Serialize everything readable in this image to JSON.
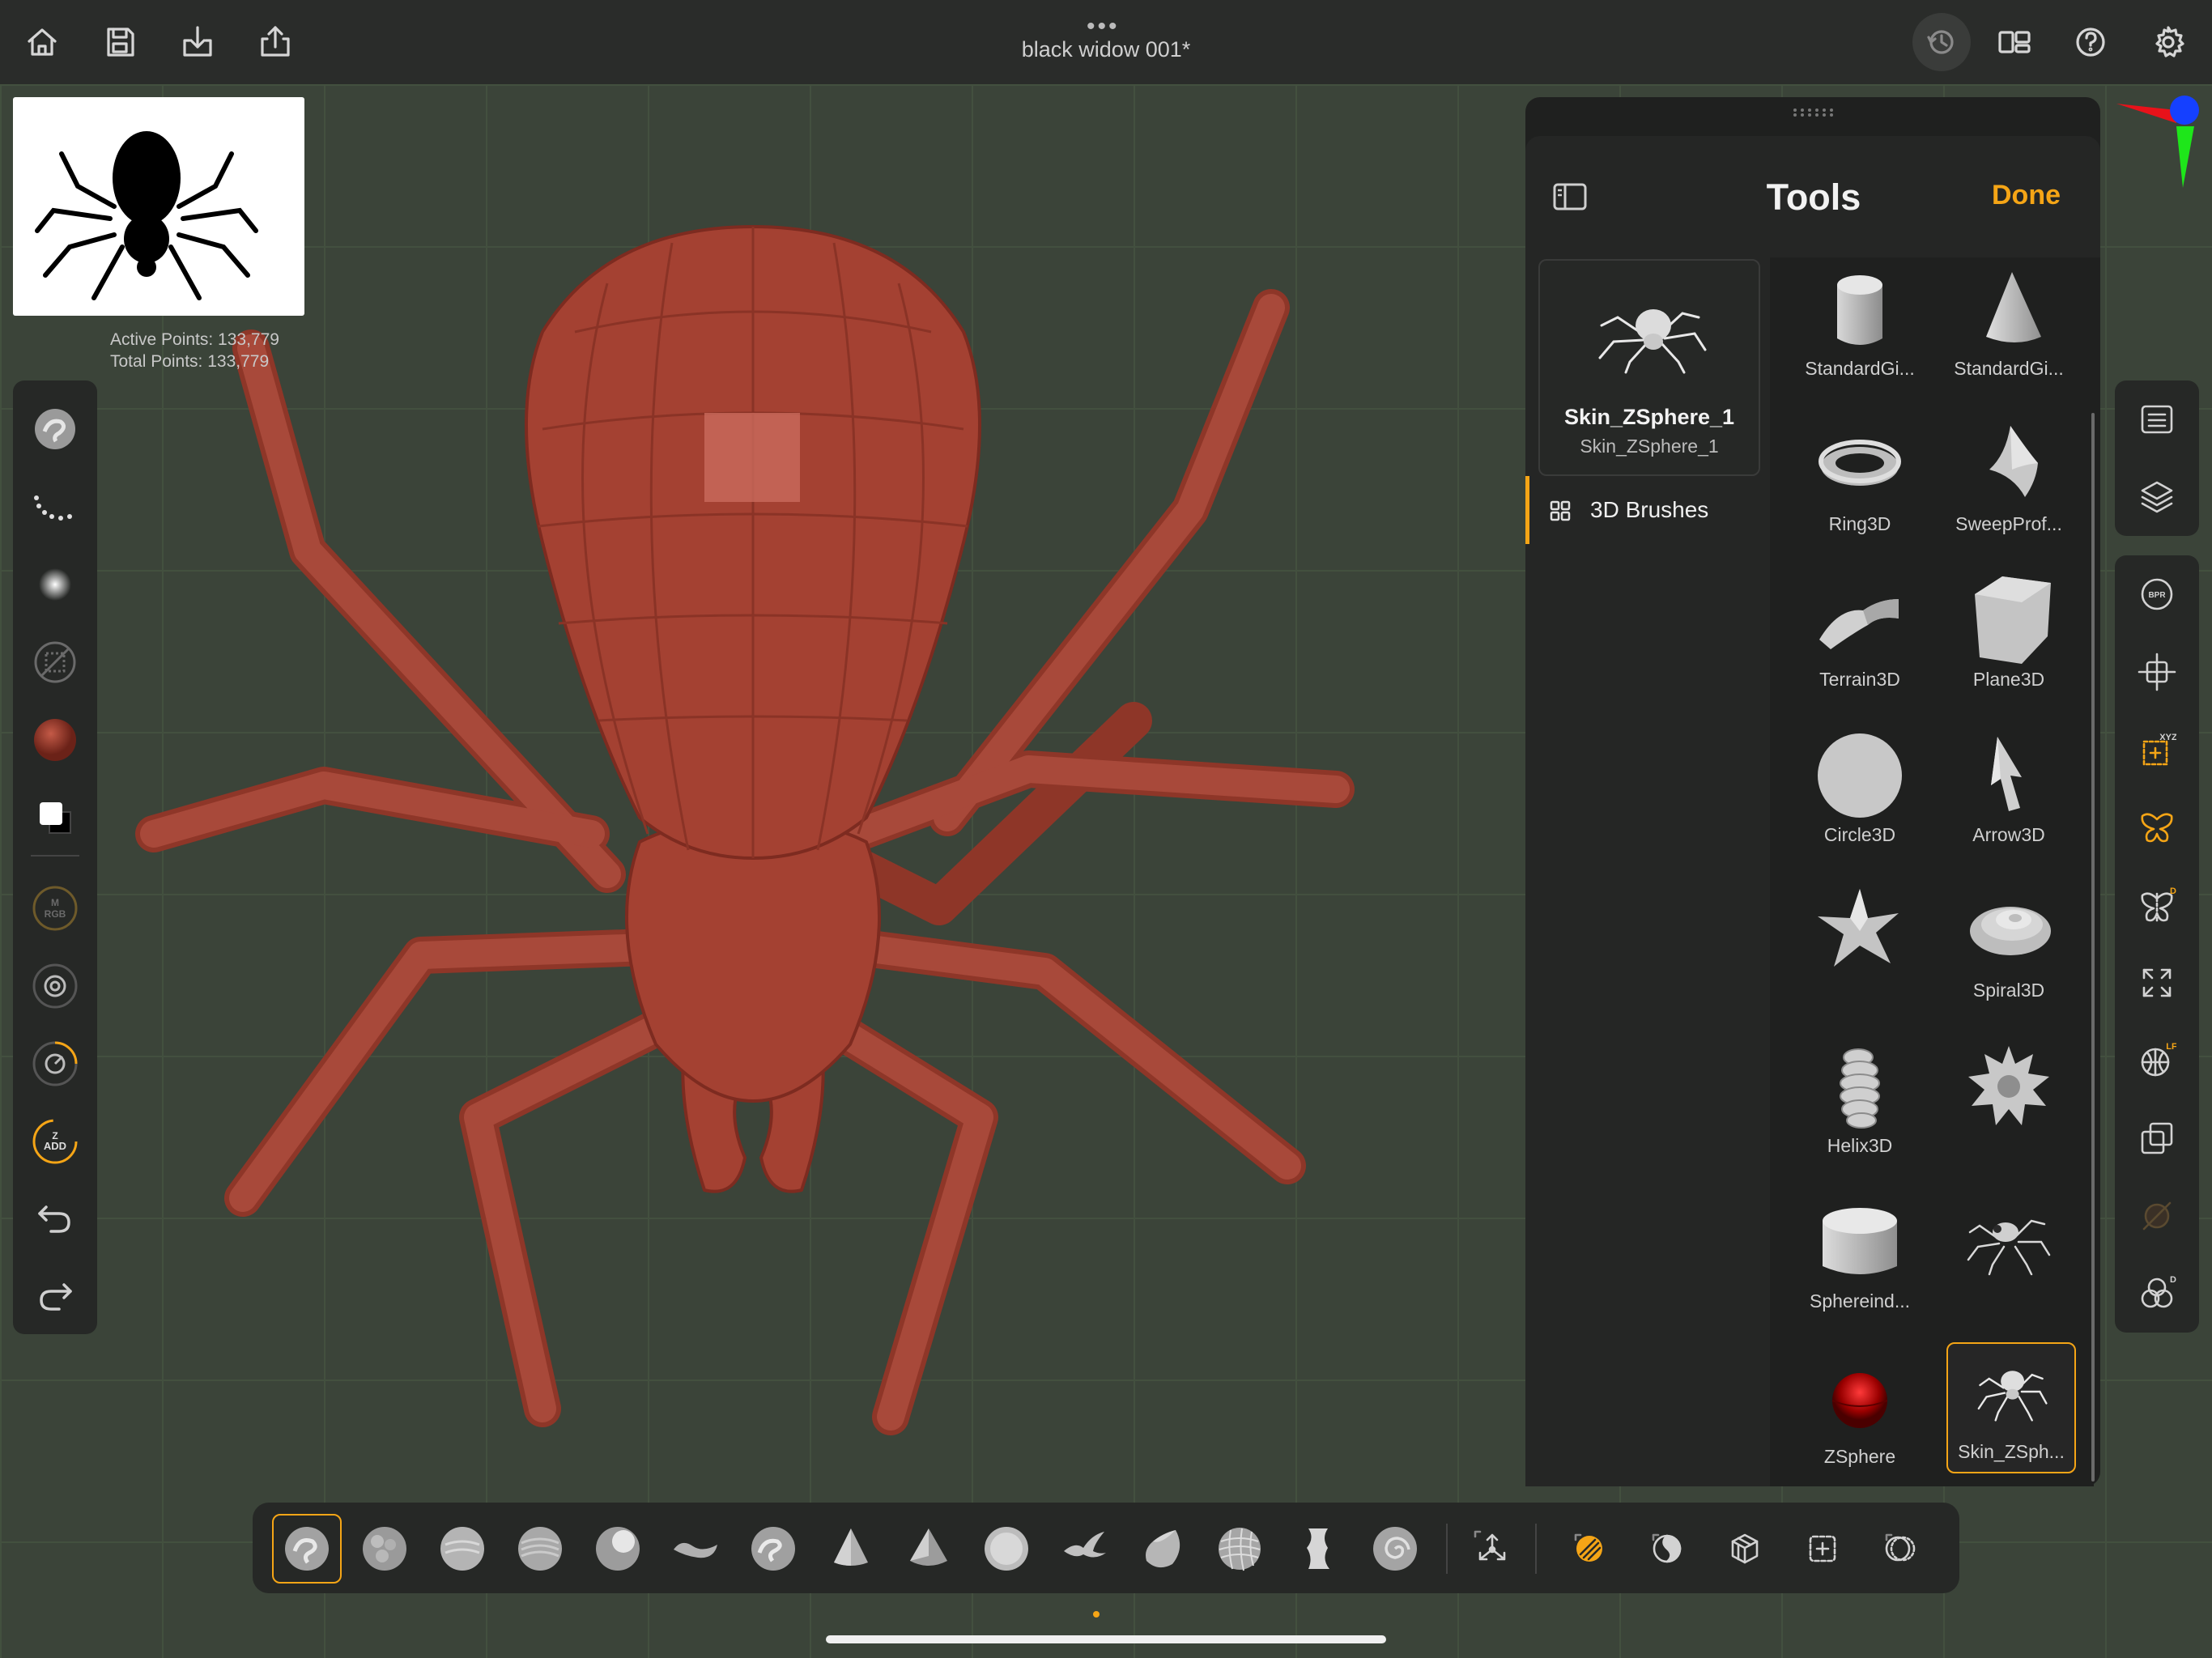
{
  "document": {
    "title": "black widow 001*"
  },
  "topbar": {
    "left_icons": [
      "home-icon",
      "save-icon",
      "import-icon",
      "share-icon"
    ],
    "right_icons": [
      "history-icon",
      "layout-icon",
      "help-icon",
      "settings-icon"
    ]
  },
  "stats": {
    "active_points": "Active Points: 133,779",
    "total_points": "Total Points: 133,779"
  },
  "left_toolbar": {
    "items": [
      "brush-icon",
      "stroke-icon",
      "alpha-icon",
      "texture-icon",
      "material-icon",
      "color-swatch-icon",
      "mrgb-icon",
      "rgb-icon",
      "zintensity-icon",
      "zadd-icon",
      "undo-icon",
      "redo-icon"
    ],
    "mrgb_label": "M\nRGB",
    "zadd_label": "ZADD"
  },
  "tools_panel": {
    "title": "Tools",
    "done_label": "Done",
    "selected_tool": {
      "name": "Skin_ZSphere_1",
      "subtitle": "Skin_ZSphere_1"
    },
    "category": "3D Brushes",
    "tiles": [
      {
        "label": "StandardGi...",
        "icon": "cylinder-icon"
      },
      {
        "label": "StandardGi...",
        "icon": "cone-icon"
      },
      {
        "label": "Ring3D",
        "icon": "ring-icon"
      },
      {
        "label": "SweepProf...",
        "icon": "sweep-icon"
      },
      {
        "label": "Terrain3D",
        "icon": "terrain-icon"
      },
      {
        "label": "Plane3D",
        "icon": "plane-icon"
      },
      {
        "label": "Circle3D",
        "icon": "circle-icon"
      },
      {
        "label": "Arrow3D",
        "icon": "arrow-icon"
      },
      {
        "label": "",
        "icon": "star-icon"
      },
      {
        "label": "Spiral3D",
        "icon": "spiral-icon"
      },
      {
        "label": "Helix3D",
        "icon": "helix-icon"
      },
      {
        "label": "",
        "icon": "gear-icon"
      },
      {
        "label": "Sphereind...",
        "icon": "sphere-cylinder-icon"
      },
      {
        "label": "",
        "icon": "spider-icon"
      },
      {
        "label": "ZSphere",
        "icon": "zsphere-icon"
      },
      {
        "label": "Skin_ZSph...",
        "icon": "spider-icon"
      }
    ]
  },
  "right_toolbar": {
    "items": [
      "list-icon",
      "layers-icon",
      "bpr-icon",
      "move-icon",
      "xyz-icon",
      "symmetry-icon",
      "symmetry-d-icon",
      "fit-icon",
      "lf-icon",
      "transform-icon",
      "material-off-icon",
      "dynamesh-icon"
    ],
    "bpr_label": "BPR",
    "xyz_label": "XYZ",
    "d_label": "D",
    "lf_label": "LF"
  },
  "bottom_toolbar": {
    "brushes": [
      "standard-brush-icon",
      "clay-brush-icon",
      "smooth-brush-icon",
      "claybuildup-brush-icon",
      "inflate-brush-icon",
      "move-brush-icon",
      "dam-brush-icon",
      "pinch-brush-icon",
      "trimdynamic-brush-icon",
      "flatten-brush-icon",
      "snakehook-brush-icon",
      "hpolish-brush-icon",
      "mesh-brush-icon",
      "clipcurve-brush-icon",
      "spiral-brush-icon"
    ],
    "tools": [
      "gizmo-icon",
      "draw-mode-icon",
      "polyframe-icon",
      "solo-icon",
      "frame-icon",
      "transparency-icon"
    ]
  },
  "colors": {
    "accent": "#f5a516",
    "model": "#a44132",
    "background": "#3b4439"
  }
}
